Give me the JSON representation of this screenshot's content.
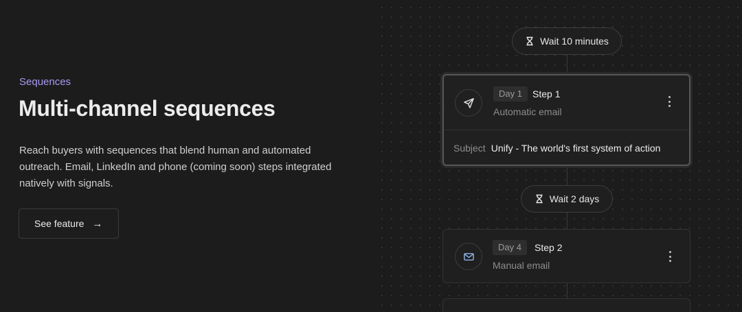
{
  "feature": {
    "eyebrow": "Sequences",
    "title": "Multi-channel sequences",
    "description": "Reach buyers with sequences that blend human and automated outreach. Email, LinkedIn and phone (coming soon) steps integrated natively with signals.",
    "cta_label": "See feature",
    "cta_icon": "arrow-right-icon"
  },
  "sequence": {
    "waits": [
      {
        "label": "Wait 10 minutes",
        "icon": "hourglass-icon"
      },
      {
        "label": "Wait 2 days",
        "icon": "hourglass-icon"
      }
    ],
    "steps": [
      {
        "day": "Day 1",
        "step": "Step 1",
        "type": "Automatic email",
        "icon": "send-icon",
        "subject_label": "Subject",
        "subject_value": "Unify - The world's first system of action",
        "selected": true
      },
      {
        "day": "Day 4",
        "step": "Step 2",
        "type": "Manual email",
        "icon": "mail-icon",
        "selected": false
      }
    ]
  },
  "colors": {
    "background": "#1c1c1c",
    "accent": "#a79bf2",
    "card_bg": "#1f1f1f",
    "mail_icon": "#8fb4e6"
  }
}
